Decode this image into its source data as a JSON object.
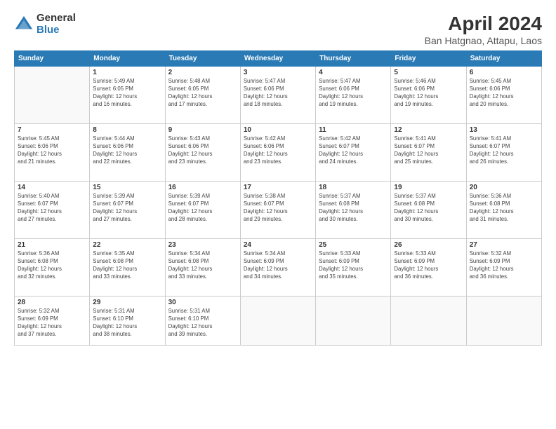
{
  "header": {
    "logo_general": "General",
    "logo_blue": "Blue",
    "month_year": "April 2024",
    "location": "Ban Hatgnao, Attapu, Laos"
  },
  "days_of_week": [
    "Sunday",
    "Monday",
    "Tuesday",
    "Wednesday",
    "Thursday",
    "Friday",
    "Saturday"
  ],
  "weeks": [
    [
      {
        "day": null,
        "info": null
      },
      {
        "day": "1",
        "info": "Sunrise: 5:49 AM\nSunset: 6:05 PM\nDaylight: 12 hours\nand 16 minutes."
      },
      {
        "day": "2",
        "info": "Sunrise: 5:48 AM\nSunset: 6:05 PM\nDaylight: 12 hours\nand 17 minutes."
      },
      {
        "day": "3",
        "info": "Sunrise: 5:47 AM\nSunset: 6:06 PM\nDaylight: 12 hours\nand 18 minutes."
      },
      {
        "day": "4",
        "info": "Sunrise: 5:47 AM\nSunset: 6:06 PM\nDaylight: 12 hours\nand 19 minutes."
      },
      {
        "day": "5",
        "info": "Sunrise: 5:46 AM\nSunset: 6:06 PM\nDaylight: 12 hours\nand 19 minutes."
      },
      {
        "day": "6",
        "info": "Sunrise: 5:45 AM\nSunset: 6:06 PM\nDaylight: 12 hours\nand 20 minutes."
      }
    ],
    [
      {
        "day": "7",
        "info": "Sunrise: 5:45 AM\nSunset: 6:06 PM\nDaylight: 12 hours\nand 21 minutes."
      },
      {
        "day": "8",
        "info": "Sunrise: 5:44 AM\nSunset: 6:06 PM\nDaylight: 12 hours\nand 22 minutes."
      },
      {
        "day": "9",
        "info": "Sunrise: 5:43 AM\nSunset: 6:06 PM\nDaylight: 12 hours\nand 23 minutes."
      },
      {
        "day": "10",
        "info": "Sunrise: 5:42 AM\nSunset: 6:06 PM\nDaylight: 12 hours\nand 23 minutes."
      },
      {
        "day": "11",
        "info": "Sunrise: 5:42 AM\nSunset: 6:07 PM\nDaylight: 12 hours\nand 24 minutes."
      },
      {
        "day": "12",
        "info": "Sunrise: 5:41 AM\nSunset: 6:07 PM\nDaylight: 12 hours\nand 25 minutes."
      },
      {
        "day": "13",
        "info": "Sunrise: 5:41 AM\nSunset: 6:07 PM\nDaylight: 12 hours\nand 26 minutes."
      }
    ],
    [
      {
        "day": "14",
        "info": "Sunrise: 5:40 AM\nSunset: 6:07 PM\nDaylight: 12 hours\nand 27 minutes."
      },
      {
        "day": "15",
        "info": "Sunrise: 5:39 AM\nSunset: 6:07 PM\nDaylight: 12 hours\nand 27 minutes."
      },
      {
        "day": "16",
        "info": "Sunrise: 5:39 AM\nSunset: 6:07 PM\nDaylight: 12 hours\nand 28 minutes."
      },
      {
        "day": "17",
        "info": "Sunrise: 5:38 AM\nSunset: 6:07 PM\nDaylight: 12 hours\nand 29 minutes."
      },
      {
        "day": "18",
        "info": "Sunrise: 5:37 AM\nSunset: 6:08 PM\nDaylight: 12 hours\nand 30 minutes."
      },
      {
        "day": "19",
        "info": "Sunrise: 5:37 AM\nSunset: 6:08 PM\nDaylight: 12 hours\nand 30 minutes."
      },
      {
        "day": "20",
        "info": "Sunrise: 5:36 AM\nSunset: 6:08 PM\nDaylight: 12 hours\nand 31 minutes."
      }
    ],
    [
      {
        "day": "21",
        "info": "Sunrise: 5:36 AM\nSunset: 6:08 PM\nDaylight: 12 hours\nand 32 minutes."
      },
      {
        "day": "22",
        "info": "Sunrise: 5:35 AM\nSunset: 6:08 PM\nDaylight: 12 hours\nand 33 minutes."
      },
      {
        "day": "23",
        "info": "Sunrise: 5:34 AM\nSunset: 6:08 PM\nDaylight: 12 hours\nand 33 minutes."
      },
      {
        "day": "24",
        "info": "Sunrise: 5:34 AM\nSunset: 6:09 PM\nDaylight: 12 hours\nand 34 minutes."
      },
      {
        "day": "25",
        "info": "Sunrise: 5:33 AM\nSunset: 6:09 PM\nDaylight: 12 hours\nand 35 minutes."
      },
      {
        "day": "26",
        "info": "Sunrise: 5:33 AM\nSunset: 6:09 PM\nDaylight: 12 hours\nand 36 minutes."
      },
      {
        "day": "27",
        "info": "Sunrise: 5:32 AM\nSunset: 6:09 PM\nDaylight: 12 hours\nand 36 minutes."
      }
    ],
    [
      {
        "day": "28",
        "info": "Sunrise: 5:32 AM\nSunset: 6:09 PM\nDaylight: 12 hours\nand 37 minutes."
      },
      {
        "day": "29",
        "info": "Sunrise: 5:31 AM\nSunset: 6:10 PM\nDaylight: 12 hours\nand 38 minutes."
      },
      {
        "day": "30",
        "info": "Sunrise: 5:31 AM\nSunset: 6:10 PM\nDaylight: 12 hours\nand 39 minutes."
      },
      {
        "day": null,
        "info": null
      },
      {
        "day": null,
        "info": null
      },
      {
        "day": null,
        "info": null
      },
      {
        "day": null,
        "info": null
      }
    ]
  ]
}
